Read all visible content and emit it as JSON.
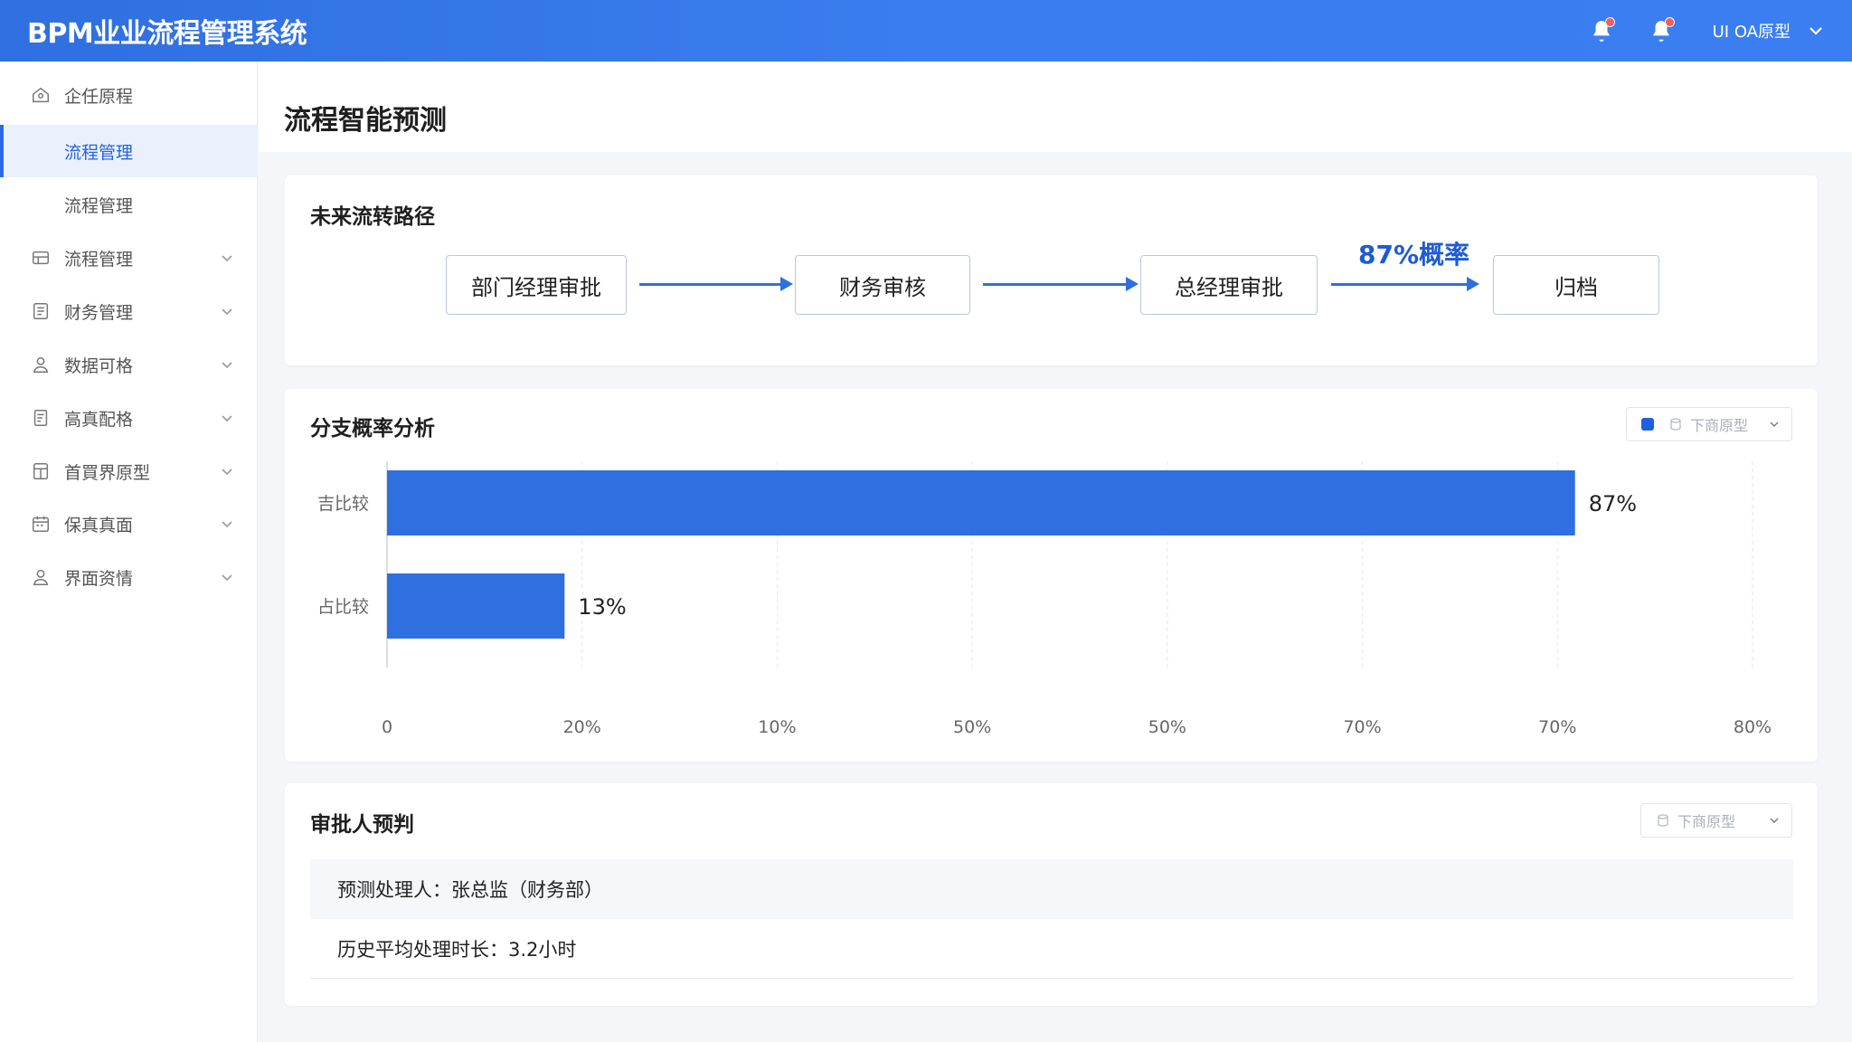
{
  "header": {
    "brand": "BPM业业流程管理系统",
    "user_label": "UI OA原型",
    "notify_icons": [
      "bell-icon",
      "bell-icon"
    ]
  },
  "sidebar": {
    "items": [
      {
        "label": "企任原程",
        "icon": "home-icon",
        "chevron": false
      },
      {
        "label": "流程管理",
        "icon": "",
        "chevron": false,
        "active": true
      },
      {
        "label": "流程管理",
        "icon": "",
        "chevron": false
      },
      {
        "label": "流程管理",
        "icon": "flow-icon",
        "chevron": true
      },
      {
        "label": "财务管理",
        "icon": "finance-icon",
        "chevron": true
      },
      {
        "label": "数据可格",
        "icon": "user-icon",
        "chevron": true
      },
      {
        "label": "高真配格",
        "icon": "document-icon",
        "chevron": true
      },
      {
        "label": "首買界原型",
        "icon": "layout-icon",
        "chevron": true
      },
      {
        "label": "保真真面",
        "icon": "calendar-icon",
        "chevron": true
      },
      {
        "label": "界面资情",
        "icon": "user-icon",
        "chevron": true
      }
    ]
  },
  "page": {
    "title": "流程智能预测"
  },
  "path_card": {
    "title": "未来流转路径",
    "nodes": [
      "部门经理审批",
      "财务审核",
      "总经理审批",
      "归档"
    ],
    "probability_label": "87%概率"
  },
  "branch_card": {
    "title": "分支概率分析",
    "dropdown_label": "下商原型",
    "legend_color": "#1e5fe0"
  },
  "chart_data": {
    "type": "bar",
    "orientation": "horizontal",
    "categories": [
      "吉比较",
      "占比较"
    ],
    "values": [
      87,
      13
    ],
    "value_labels": [
      "87%",
      "13%"
    ],
    "x_ticks": [
      "0",
      "20%",
      "10%",
      "50%",
      "50%",
      "70%",
      "70%",
      "80%"
    ],
    "bar_color": "#2f6fe0",
    "grid": true
  },
  "approver_card": {
    "title": "审批人预判",
    "dropdown_label": "下商原型",
    "rows": [
      "预测处理人：张总监（财务部）",
      "历史平均处理时长：3.2小时"
    ]
  }
}
